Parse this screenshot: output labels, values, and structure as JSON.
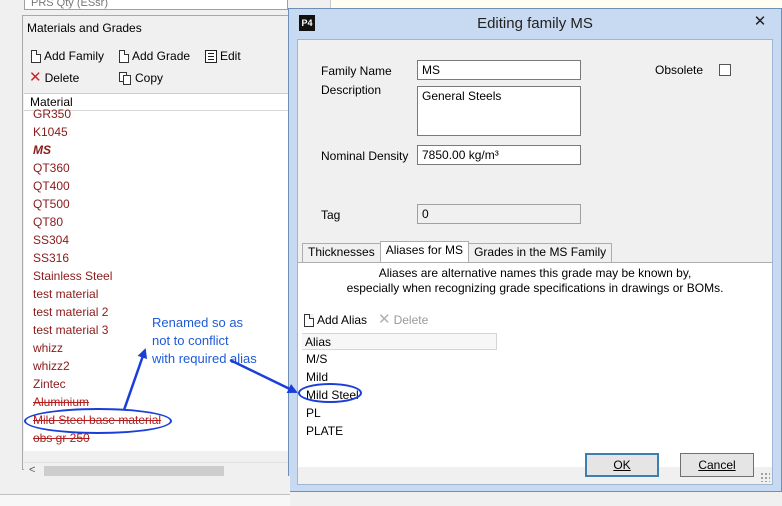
{
  "top_strip": {
    "tree_text": "PRS Qty (ESsr)"
  },
  "left_panel": {
    "title": "Materials and Grades",
    "toolbar": {
      "add_family": "Add Family",
      "add_grade": "Add Grade",
      "edit": "Edit",
      "delete": "Delete",
      "copy": "Copy"
    },
    "list_header": "Material",
    "items": [
      {
        "label": "GR350",
        "style": "normal"
      },
      {
        "label": "K1045",
        "style": "normal"
      },
      {
        "label": "MS",
        "style": "bold"
      },
      {
        "label": "QT360",
        "style": "normal"
      },
      {
        "label": "QT400",
        "style": "normal"
      },
      {
        "label": "QT500",
        "style": "normal"
      },
      {
        "label": "QT80",
        "style": "normal"
      },
      {
        "label": "SS304",
        "style": "normal"
      },
      {
        "label": "SS316",
        "style": "normal"
      },
      {
        "label": "Stainless Steel",
        "style": "normal"
      },
      {
        "label": "test material",
        "style": "normal"
      },
      {
        "label": "test material 2",
        "style": "normal"
      },
      {
        "label": "test material 3",
        "style": "normal"
      },
      {
        "label": "whizz",
        "style": "normal"
      },
      {
        "label": "whizz2",
        "style": "normal"
      },
      {
        "label": "Zintec",
        "style": "normal"
      },
      {
        "label": "Aluminium",
        "style": "strike"
      },
      {
        "label": "Mild Steel base material",
        "style": "strike"
      },
      {
        "label": "obs gr 250",
        "style": "strike"
      }
    ]
  },
  "annotation": {
    "lines": [
      "Renamed so as",
      "not to conflict",
      "with required alias"
    ],
    "color": "#1e5bd8"
  },
  "dialog": {
    "app_icon": "P4",
    "title": "Editing family MS",
    "close_glyph": "✕",
    "family_name_label": "Family Name",
    "family_name_value": "MS",
    "description_label": "Description",
    "description_value": "General Steels",
    "obsolete_label": "Obsolete",
    "nominal_density_label": "Nominal Density",
    "nominal_density_value": "7850.00 kg/m³",
    "tag_label": "Tag",
    "tag_value": "0",
    "tabs": [
      "Thicknesses",
      "Aliases for MS",
      "Grades in the MS Family"
    ],
    "active_tab": 1,
    "info_line1": "Aliases are alternative names this grade may be known by,",
    "info_line2": "especially when recognizing grade specifications in drawings or BOMs.",
    "add_alias": "Add Alias",
    "delete": "Delete",
    "alias_header": "Alias",
    "aliases": [
      "M/S",
      "Mild",
      "Mild Steel",
      "PL",
      "PLATE"
    ],
    "ok": "OK",
    "cancel": "Cancel"
  }
}
